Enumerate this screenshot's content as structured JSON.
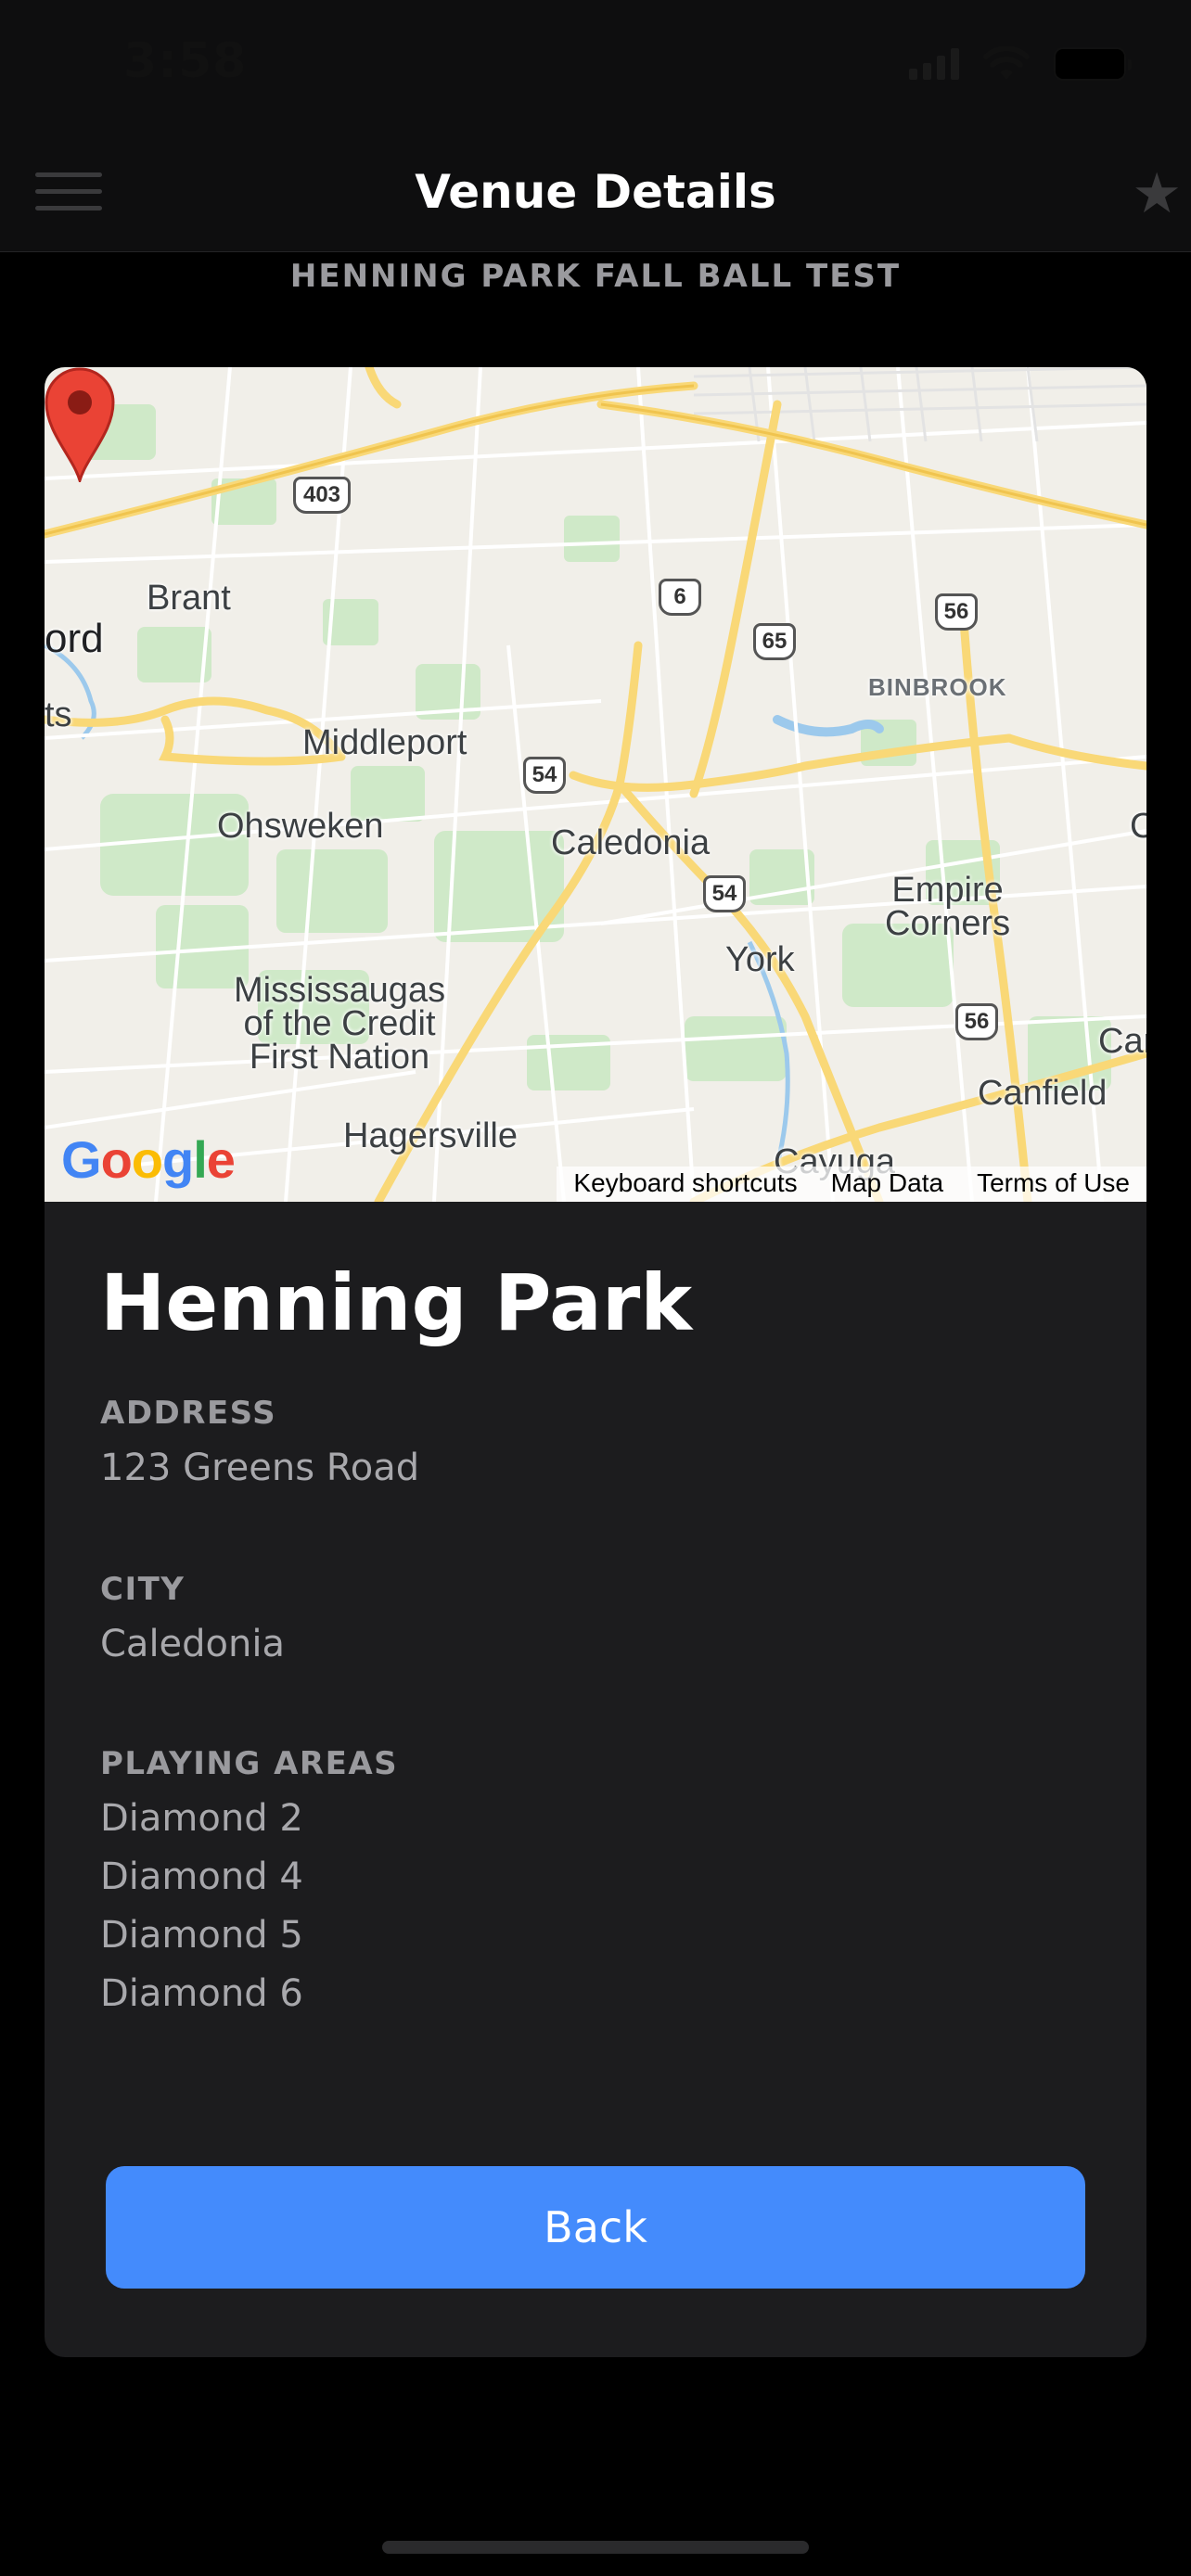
{
  "status_bar": {
    "time": "3:58"
  },
  "nav": {
    "title": "Venue Details"
  },
  "subtitle": "HENNING PARK FALL BALL TEST",
  "map": {
    "labels": {
      "brant": "Brant",
      "ford": "ord",
      "ts": "ts",
      "middleport": "Middleport",
      "ohsweken": "Ohsweken",
      "caledonia": "Caledonia",
      "binbrook": "BINBROOK",
      "empire_corners": "Empire\nCorners",
      "york": "York",
      "mississaugas": "Mississaugas\nof the Credit\nFirst Nation",
      "hagersville": "Hagersville",
      "canfield": "Canfield",
      "cayuga": "Cayuga",
      "car": "Car",
      "c": "C"
    },
    "shields": {
      "r403": "403",
      "r6": "6",
      "r65": "65",
      "r56a": "56",
      "r54a": "54",
      "r54b": "54",
      "r56b": "56"
    },
    "footer": {
      "keyboard": "Keyboard shortcuts",
      "map_data": "Map Data",
      "terms": "Terms of Use"
    },
    "logo": "Google"
  },
  "venue": {
    "name": "Henning Park",
    "address_label": "ADDRESS",
    "address": "123 Greens Road",
    "city_label": "CITY",
    "city": "Caledonia",
    "areas_label": "PLAYING AREAS",
    "areas": [
      "Diamond 2",
      "Diamond 4",
      "Diamond 5",
      "Diamond 6"
    ]
  },
  "back_button": {
    "label": "Back"
  },
  "colors": {
    "accent": "#448bfc",
    "card": "#1c1c1e",
    "background": "#000000"
  }
}
